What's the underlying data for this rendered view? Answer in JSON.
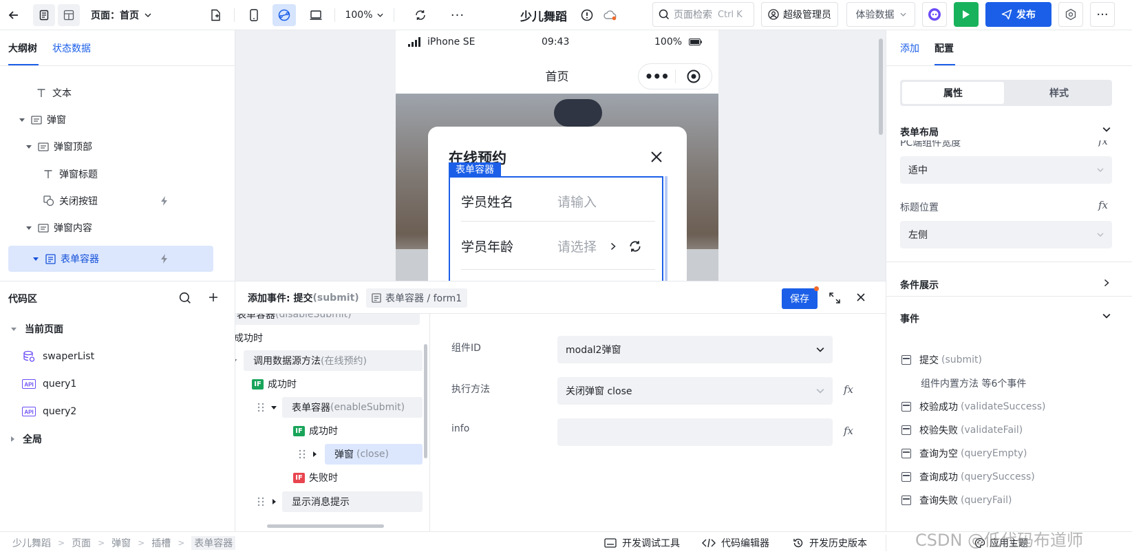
{
  "topbar": {
    "page_label": "页面：首页",
    "zoom": "100%",
    "app_title": "少儿舞蹈",
    "search_placeholder": "页面检索",
    "search_shortcut": "Ctrl K",
    "user": "超级管理员",
    "data_mode": "体验数据",
    "publish": "发布"
  },
  "left": {
    "tabs": [
      "大纲树",
      "状态数据"
    ],
    "tree": [
      {
        "label": "文本",
        "icon": "text-icon"
      },
      {
        "label": "弹窗",
        "icon": "container-icon"
      },
      {
        "label": "弹窗顶部",
        "icon": "container-icon"
      },
      {
        "label": "弹窗标题",
        "icon": "text-icon"
      },
      {
        "label": "关闭按钮",
        "icon": "button-icon"
      },
      {
        "label": "弹窗内容",
        "icon": "container-icon"
      },
      {
        "label": "表单容器",
        "icon": "form-icon"
      }
    ],
    "code_title": "代码区",
    "code_tree": {
      "current_page": "当前页面",
      "items": [
        "swaperList",
        "query1",
        "query2"
      ],
      "global": "全局"
    }
  },
  "phone": {
    "carrier": "iPhone SE",
    "time": "09:43",
    "battery": "100%",
    "nav_title": "首页",
    "modal_title": "在线预约",
    "form_tag": "表单容器",
    "fields": [
      {
        "label": "学员姓名",
        "placeholder": "请输入"
      },
      {
        "label": "学员年龄",
        "placeholder": "请选择"
      }
    ]
  },
  "event": {
    "title_prefix": "添加事件: 提交",
    "title_code": "(submit)",
    "path": "表单容器 / form1",
    "save": "保存",
    "flow": [
      {
        "text": "表单容器",
        "code": "(disableSubmit)"
      },
      {
        "text": "成功时"
      },
      {
        "text": "调用数据源方法",
        "code": "(在线预约)"
      },
      {
        "text": "成功时",
        "badge": "IF"
      },
      {
        "text": "表单容器",
        "code": "(enableSubmit)"
      },
      {
        "text": "成功时",
        "badge": "IF"
      },
      {
        "text": "弹窗",
        "code": "(close)"
      },
      {
        "text": "失败时",
        "badge": "IF"
      },
      {
        "text": "显示消息提示"
      }
    ],
    "props": [
      {
        "label": "组件ID",
        "value": "modal2弹窗"
      },
      {
        "label": "执行方法",
        "value": "关闭弹窗 close"
      },
      {
        "label": "info",
        "value": ""
      }
    ],
    "fx": "fx"
  },
  "right": {
    "tabs": [
      "添加",
      "配置"
    ],
    "seg": [
      "属性",
      "样式"
    ],
    "form_layout": "表单布局",
    "pc_width_label": "PC端组件宽度",
    "pc_width_value": "适中",
    "title_pos_label": "标题位置",
    "title_pos_value": "左侧",
    "cond_show": "条件展示",
    "events_title": "事件",
    "events": [
      {
        "name": "提交",
        "code": "(submit)"
      },
      {
        "name": "组件内置方法 等6个事件",
        "code": ""
      },
      {
        "name": "校验成功",
        "code": "(validateSuccess)"
      },
      {
        "name": "校验失败",
        "code": "(validateFail)"
      },
      {
        "name": "查询为空",
        "code": "(queryEmpty)"
      },
      {
        "name": "查询成功",
        "code": "(querySuccess)"
      },
      {
        "name": "查询失败",
        "code": "(queryFail)"
      }
    ]
  },
  "footer": {
    "breadcrumb": [
      "少儿舞蹈",
      "页面",
      "弹窗",
      "插槽",
      "表单容器"
    ],
    "tools": [
      "开发调试工具",
      "代码编辑器",
      "开发历史版本",
      "应用主题"
    ],
    "watermark": "CSDN @低代码布道师"
  }
}
